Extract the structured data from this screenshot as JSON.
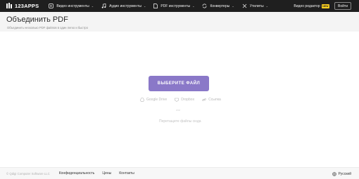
{
  "topbar": {
    "logo": "123APPS",
    "nav": [
      {
        "label": "Видео инструменты",
        "icon": "video-icon"
      },
      {
        "label": "Аудио инструменты",
        "icon": "music-icon"
      },
      {
        "label": "PDF инструменты",
        "icon": "document-icon"
      },
      {
        "label": "Конвертеры",
        "icon": "refresh-icon"
      },
      {
        "label": "Утилиты",
        "icon": "tools-icon"
      }
    ],
    "video_editor": "Видео редактор",
    "badge": "NEW",
    "login": "Войти"
  },
  "header": {
    "title": "Объединить PDF",
    "subtitle": "Объединить несколько PDF файлов в один легко и быстро"
  },
  "upload": {
    "button": "ВЫБЕРИТЕ ФАЙЛ",
    "sources": [
      {
        "label": "Google Drive",
        "icon": "google-drive-icon"
      },
      {
        "label": "Dropbox",
        "icon": "dropbox-icon"
      },
      {
        "label": "Ссылка",
        "icon": "link-icon"
      }
    ],
    "or": "или",
    "drop_hint": "Перетащите файлы сюда"
  },
  "footer": {
    "copyright": "© Qdigi Computer Software LLC",
    "links": [
      "Конфиденциальность",
      "Цены",
      "Контакты"
    ],
    "language": "Русский"
  },
  "colors": {
    "topbar": "#1f1f1f",
    "accent": "#8a78c8",
    "badge": "#ffd21f"
  }
}
